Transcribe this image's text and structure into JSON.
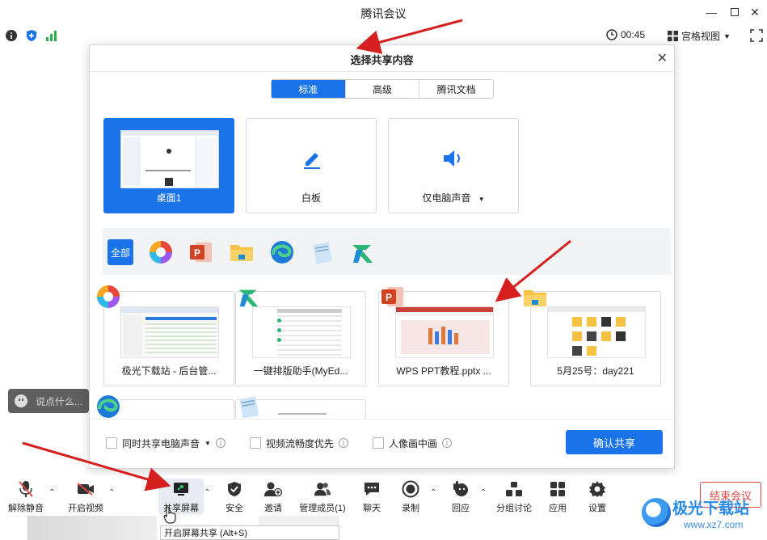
{
  "window": {
    "title": "腾讯会议"
  },
  "status": {
    "timer": "00:45",
    "view_label": "宫格视图"
  },
  "say_placeholder": "说点什么...",
  "dialog": {
    "title": "选择共享内容",
    "tabs": [
      "标准",
      "高级",
      "腾讯文档"
    ],
    "big_cards": [
      {
        "label": "桌面1"
      },
      {
        "label": "白板"
      },
      {
        "label": "仅电脑声音"
      }
    ],
    "filter_all": "全部",
    "windows": [
      {
        "label": "极光下载站 - 后台管..."
      },
      {
        "label": "一键排版助手(MyEd..."
      },
      {
        "label": "WPS PPT教程.pptx ..."
      },
      {
        "label": "5月25号：day221"
      }
    ],
    "options": [
      {
        "label": "同时共享电脑声音"
      },
      {
        "label": "视频流畅度优先"
      },
      {
        "label": "人像画中画"
      }
    ],
    "confirm": "确认共享"
  },
  "toolbar": {
    "items": [
      "解除静音",
      "开启视频",
      "共享屏幕",
      "安全",
      "邀请",
      "管理成员(1)",
      "聊天",
      "录制",
      "回应",
      "分组讨论",
      "应用",
      "设置"
    ],
    "end": "结束会议",
    "tooltip": "开启屏幕共享 (Alt+S)"
  },
  "watermark": {
    "brand": "极光下载站",
    "url": "www.xz7.com"
  },
  "colors": {
    "accent": "#1a73e8",
    "end": "#e04848",
    "arrow": "#d61f1f"
  }
}
